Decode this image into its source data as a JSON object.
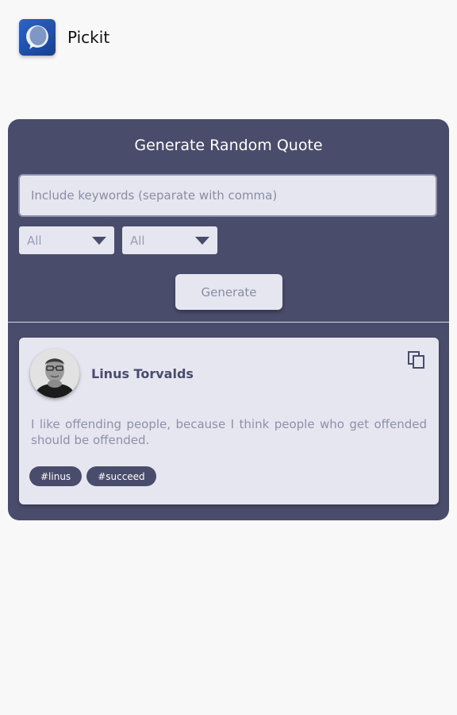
{
  "app": {
    "name": "Pickit",
    "logo_icon": "speech-bubble-icon"
  },
  "generator": {
    "title": "Generate Random Quote",
    "keywords_placeholder": "Include keywords (separate with comma)",
    "keywords_value": "",
    "filter_1": "All",
    "filter_2": "All",
    "generate_label": "Generate"
  },
  "quote": {
    "author": "Linus Torvalds",
    "text": "I like offending people, because I think people who get offended should be offended.",
    "tags": [
      "#linus",
      "#succeed"
    ],
    "copy_icon": "copy-icon",
    "avatar": "author-avatar"
  },
  "colors": {
    "panel": "#4a4c6b",
    "card": "#e6e6f1",
    "background": "#f8f8f9"
  }
}
